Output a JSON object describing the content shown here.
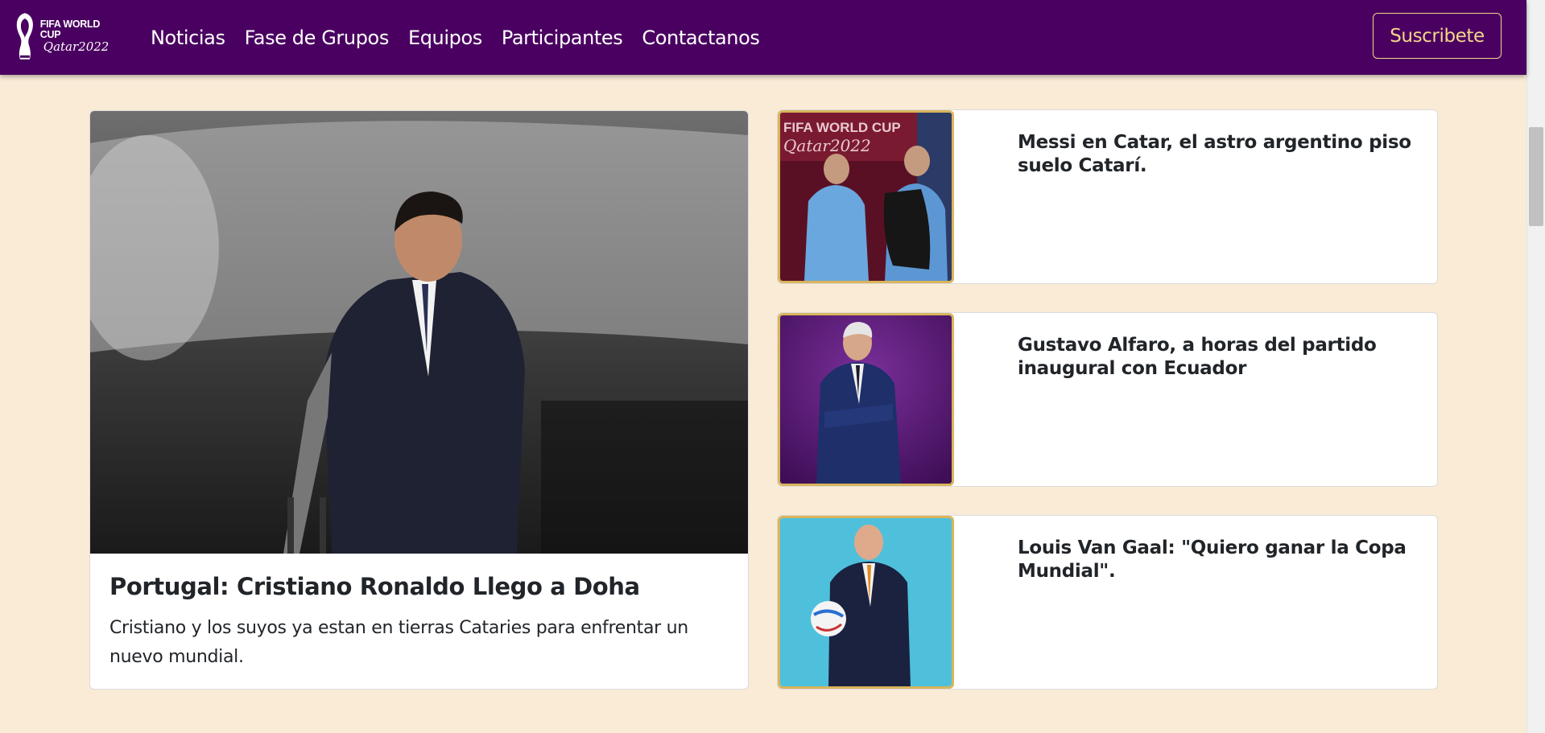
{
  "brand": {
    "line1": "FIFA WORLD CUP",
    "line2": "Qatar2022"
  },
  "nav": {
    "links": [
      "Noticias",
      "Fase de Grupos",
      "Equipos",
      "Participantes",
      "Contactanos"
    ],
    "subscribe_label": "Suscribete"
  },
  "colors": {
    "navbar": "#4a0061",
    "page_background": "#faebd7",
    "accent_gold": "#f3d68a",
    "image_border": "#d9b55a"
  },
  "featured": {
    "title": "Portugal: Cristiano Ronaldo Llego a Doha",
    "text": "Cristiano y los suyos ya estan en tierras Cataries para enfrentar un nuevo mundial."
  },
  "side_news": [
    {
      "title": "Messi en Catar, el astro argentino piso suelo Catarí."
    },
    {
      "title": "Gustavo Alfaro, a horas del partido inaugural con Ecuador"
    },
    {
      "title": "Louis Van Gaal: \"Quiero ganar la Copa Mundial\"."
    }
  ]
}
